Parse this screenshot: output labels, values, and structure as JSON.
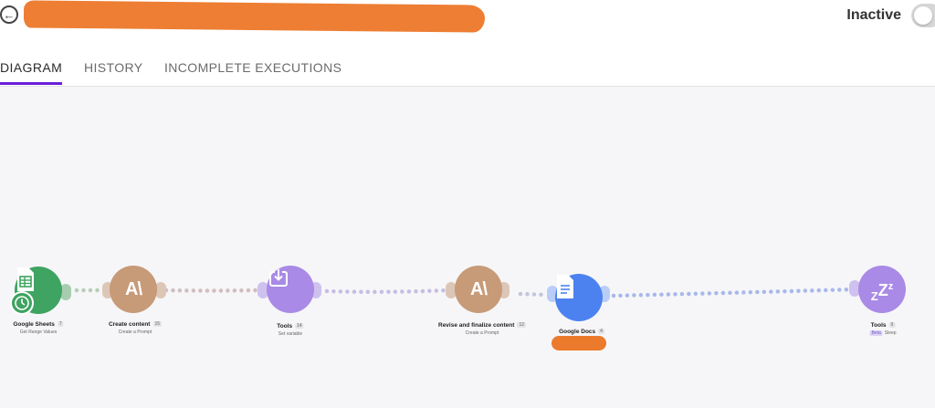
{
  "header": {
    "back_icon": "arrow-left-circle-icon",
    "title": "",
    "status_label": "Inactive",
    "toggle_on": false
  },
  "tabs": [
    {
      "label": "DIAGRAM",
      "active": true
    },
    {
      "label": "HISTORY",
      "active": false
    },
    {
      "label": "INCOMPLETE EXECUTIONS",
      "active": false
    }
  ],
  "modules": [
    {
      "name": "Google Sheets",
      "count": "7",
      "subtitle": "Get Range Values",
      "icon": "spreadsheet-icon",
      "color": "#3fa361"
    },
    {
      "name": "Create content",
      "count": "15",
      "subtitle": "Create a Prompt",
      "icon": "anthropic-icon",
      "color": "#c79a78"
    },
    {
      "name": "Tools",
      "count": "14",
      "subtitle": "Set variable",
      "icon": "download-box-icon",
      "color": "#a98ae6"
    },
    {
      "name": "Revise and finalize content",
      "count": "12",
      "subtitle": "Create a Prompt",
      "icon": "anthropic-icon",
      "color": "#c79a78"
    },
    {
      "name": "Google Docs",
      "count": "4",
      "subtitle": "",
      "icon": "document-icon",
      "color": "#4c82f0"
    },
    {
      "name": "Tools",
      "count": "9",
      "badge": "Beta",
      "subtitle": "Sleep",
      "icon": "sleep-zz-icon",
      "color": "#a98ae6"
    }
  ],
  "colors": {
    "accent": "#6a1fd8",
    "canvas_bg": "#f6f6f8",
    "redaction": "#ec7a2c"
  }
}
